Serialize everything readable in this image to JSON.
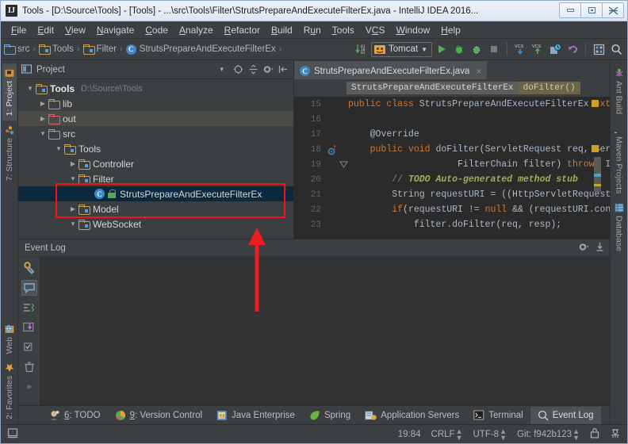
{
  "window": {
    "title": "Tools - [D:\\Source\\Tools] - [Tools] - ...\\src\\Tools\\Filter\\StrutsPrepareAndExecuteFilterEx.java - IntelliJ IDEA 2016...",
    "app_icon": "IJ",
    "controls": {
      "minimize": "minimize-icon",
      "maximize": "maximize-icon",
      "close": "✕"
    }
  },
  "menu": {
    "items": [
      {
        "mnemonic": "F",
        "rest": "ile"
      },
      {
        "mnemonic": "E",
        "rest": "dit"
      },
      {
        "mnemonic": "V",
        "rest": "iew"
      },
      {
        "mnemonic": "N",
        "rest": "avigate"
      },
      {
        "mnemonic": "C",
        "rest": "ode"
      },
      {
        "mnemonic": "A",
        "rest": "nalyze"
      },
      {
        "mnemonic": "R",
        "rest": "efactor"
      },
      {
        "mnemonic": "B",
        "rest": "uild"
      },
      {
        "mnemonic": "R",
        "rest": "un",
        "pre": "R",
        "post": "un"
      },
      {
        "mnemonic": "T",
        "rest": "ools"
      },
      {
        "mnemonic": "V",
        "rest": "CS"
      },
      {
        "mnemonic": "W",
        "rest": "indow"
      },
      {
        "mnemonic": "H",
        "rest": "elp"
      }
    ]
  },
  "toolbar": {
    "breadcrumb": [
      {
        "label": "src",
        "icon": "folder-blue-icon"
      },
      {
        "label": "Tools",
        "icon": "folder-tan-icon"
      },
      {
        "label": "Filter",
        "icon": "folder-tan-icon"
      },
      {
        "label": "StrutsPrepareAndExecuteFilterEx",
        "icon": "class-icon"
      }
    ],
    "separator": "›",
    "run_config": "Tomcat",
    "icons": [
      "sort-numeric-icon",
      "run-icon",
      "debug-icon",
      "coverage-icon",
      "stop-icon",
      "vcs-update-icon",
      "vcs-commit-icon",
      "vcs-history-icon",
      "undo-icon",
      "layout-icon",
      "search-icon"
    ]
  },
  "left_tool_bar": {
    "tabs": [
      {
        "label": "1: Project",
        "icon": "project-icon",
        "selected": true
      },
      {
        "label": "7: Structure",
        "icon": "structure-icon",
        "selected": false
      },
      {
        "label": "Web",
        "icon": "web-icon",
        "selected": false
      },
      {
        "label": "2: Favorites",
        "icon": "star-icon",
        "selected": false
      }
    ]
  },
  "right_tool_bar": {
    "tabs": [
      {
        "label": "Ant Build",
        "icon": "ant-icon"
      },
      {
        "label": "Maven Projects",
        "icon": "maven-icon"
      },
      {
        "label": "Database",
        "icon": "database-icon"
      }
    ]
  },
  "project_panel": {
    "title": "Project",
    "dropdown_caret": "▾",
    "tools": [
      "target-icon",
      "collapse-all-icon",
      "gear-icon",
      "hide-icon"
    ],
    "tree": [
      {
        "depth": 0,
        "twisty": "▼",
        "label": "Tools",
        "icon": "module-icon",
        "bold": true,
        "path": "D:\\Source\\Tools"
      },
      {
        "depth": 1,
        "twisty": "▶",
        "label": "lib",
        "icon": "folder-tan-icon"
      },
      {
        "depth": 1,
        "twisty": "▶",
        "label": "out",
        "icon": "folder-red-icon",
        "highlight": true
      },
      {
        "depth": 1,
        "twisty": "▼",
        "label": "src",
        "icon": "folder-blue-icon"
      },
      {
        "depth": 2,
        "twisty": "▼",
        "label": "Tools",
        "icon": "package-icon"
      },
      {
        "depth": 3,
        "twisty": "▶",
        "label": "Controller",
        "icon": "package-icon"
      },
      {
        "depth": 3,
        "twisty": "▼",
        "label": "Filter",
        "icon": "package-icon"
      },
      {
        "depth": 4,
        "twisty": "",
        "label": "StrutsPrepareAndExecuteFilterEx",
        "icon": "class-icon",
        "lock": true,
        "selected": true
      },
      {
        "depth": 3,
        "twisty": "▶",
        "label": "Model",
        "icon": "package-icon"
      },
      {
        "depth": 3,
        "twisty": "▼",
        "label": "WebSocket",
        "icon": "package-icon"
      }
    ]
  },
  "editor": {
    "tab": {
      "label": "StrutsPrepareAndExecuteFilterEx.java",
      "icon": "class-icon",
      "close": "×"
    },
    "breadcrumbs": [
      {
        "label": "StrutsPrepareAndExecuteFilterEx",
        "style": "a"
      },
      {
        "label": "doFilter()",
        "style": "b"
      }
    ],
    "lines": [
      {
        "num": "15",
        "html": "<span class=\"kw\">public class</span> <span class=\"pl\">StrutsPrepareAndExecuteFilterEx</span> <span class=\"kw\">extend</span>"
      },
      {
        "num": "16",
        "html": ""
      },
      {
        "num": "17",
        "html": "    <span class=\"pl\">@Override</span>"
      },
      {
        "num": "18",
        "html": "    <span class=\"kw\">public void</span> <span class=\"pl\">doFilter</span>(<span class=\"pl\">ServletRequest req, ServletR</span>"
      },
      {
        "num": "19",
        "html": "                    <span class=\"pl\">FilterChain filter</span>) <span class=\"kw\">throws</span> <span class=\"pl\">I</span>"
      },
      {
        "num": "20",
        "html": "        <span class=\"cm\">// </span><span class=\"todo\">TODO Auto-generated method stub</span>"
      },
      {
        "num": "21",
        "html": "        <span class=\"pl\">String requestURI = ((HttpServletRequest) req</span>"
      },
      {
        "num": "22",
        "html": "        <span class=\"kw\">if</span>(<span class=\"pl\">requestURI != </span><span class=\"kw\">null</span><span class=\"pl\"> &amp;&amp; (requestURI.contains</span>"
      },
      {
        "num": "23",
        "html": "            <span class=\"pl\">filter.doFilter(req, resp);</span>"
      }
    ]
  },
  "event_log": {
    "title": "Event Log",
    "tools": [
      "gear-icon",
      "hide-icon"
    ],
    "side_icons": [
      "settings-wrench-icon",
      "console-icon",
      "expand-icon",
      "export-icon",
      "select-icon",
      "trash-icon",
      "more-icon"
    ],
    "more": "»"
  },
  "tool_window_bar": {
    "items": [
      {
        "mnemonic": "6",
        "label": ": TODO",
        "icon": "todo-icon",
        "selected": false
      },
      {
        "mnemonic": "9",
        "label": ": Version Control",
        "icon": "vcs-icon",
        "selected": false
      },
      {
        "mnemonic": "",
        "label": "Java Enterprise",
        "icon": "java-ee-icon",
        "selected": false
      },
      {
        "mnemonic": "",
        "label": "Spring",
        "icon": "spring-leaf-icon",
        "selected": false
      },
      {
        "mnemonic": "",
        "label": "Application Servers",
        "icon": "app-servers-icon",
        "selected": false
      },
      {
        "mnemonic": "",
        "label": "Terminal",
        "icon": "terminal-icon",
        "selected": false
      },
      {
        "mnemonic": "",
        "label": "Event Log",
        "icon": "magnifier-icon",
        "selected": true
      }
    ]
  },
  "status_bar": {
    "left_icon": "memory-indicator-icon",
    "caret_position": "19:84",
    "line_separator": "CRLF",
    "encoding": "UTF-8",
    "vcs_branch": "Git: f942b123",
    "lock_icon": "read-only-lock-icon",
    "inspection_icon": "hector-icon",
    "updown": "↕"
  },
  "annotation": {
    "box_color": "#f11515",
    "arrow_color": "#ed1c24"
  }
}
